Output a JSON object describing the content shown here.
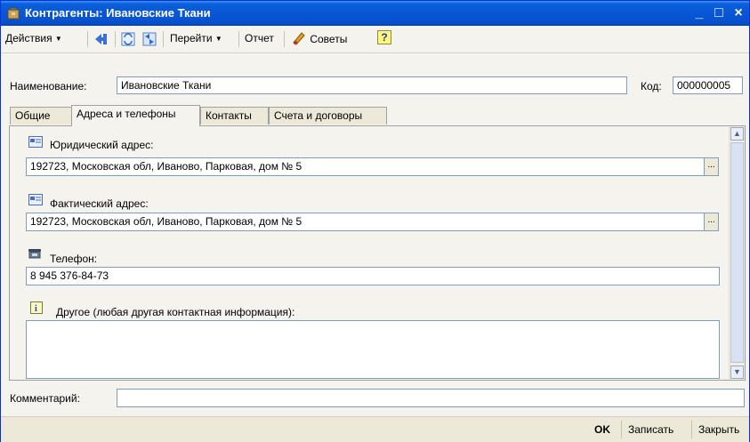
{
  "window": {
    "title": "Контрагенты: Ивановские Ткани",
    "minimize": "_",
    "maximize": "□",
    "close": "×"
  },
  "toolbar": {
    "actions": "Действия",
    "goto": "Перейти",
    "report": "Отчет",
    "tips": "Советы",
    "help": "?"
  },
  "header": {
    "name_label": "Наименование:",
    "name_value": "Ивановские Ткани",
    "code_label": "Код:",
    "code_value": "000000005"
  },
  "tabs": [
    {
      "label": "Общие"
    },
    {
      "label": "Адреса и телефоны"
    },
    {
      "label": "Контакты"
    },
    {
      "label": "Счета и договоры"
    }
  ],
  "addresses": {
    "legal_label": "Юридический адрес:",
    "legal_value": "192723, Московская обл, Иваново, Парковая, дом № 5",
    "actual_label": "Фактический адрес:",
    "actual_value": "192723, Московская обл, Иваново, Парковая, дом № 5",
    "phone_label": "Телефон:",
    "phone_value": "8 945 376-84-73",
    "other_label": "Другое (любая другая контактная информация):",
    "other_value": "",
    "ellipsis": "..."
  },
  "comment": {
    "label": "Комментарий:",
    "value": ""
  },
  "footer": {
    "ok": "OK",
    "save": "Записать",
    "close": "Закрыть"
  },
  "colors": {
    "title_bar": "#0856d6",
    "panel": "#f4f3ee",
    "field_border": "#7f9db9"
  }
}
